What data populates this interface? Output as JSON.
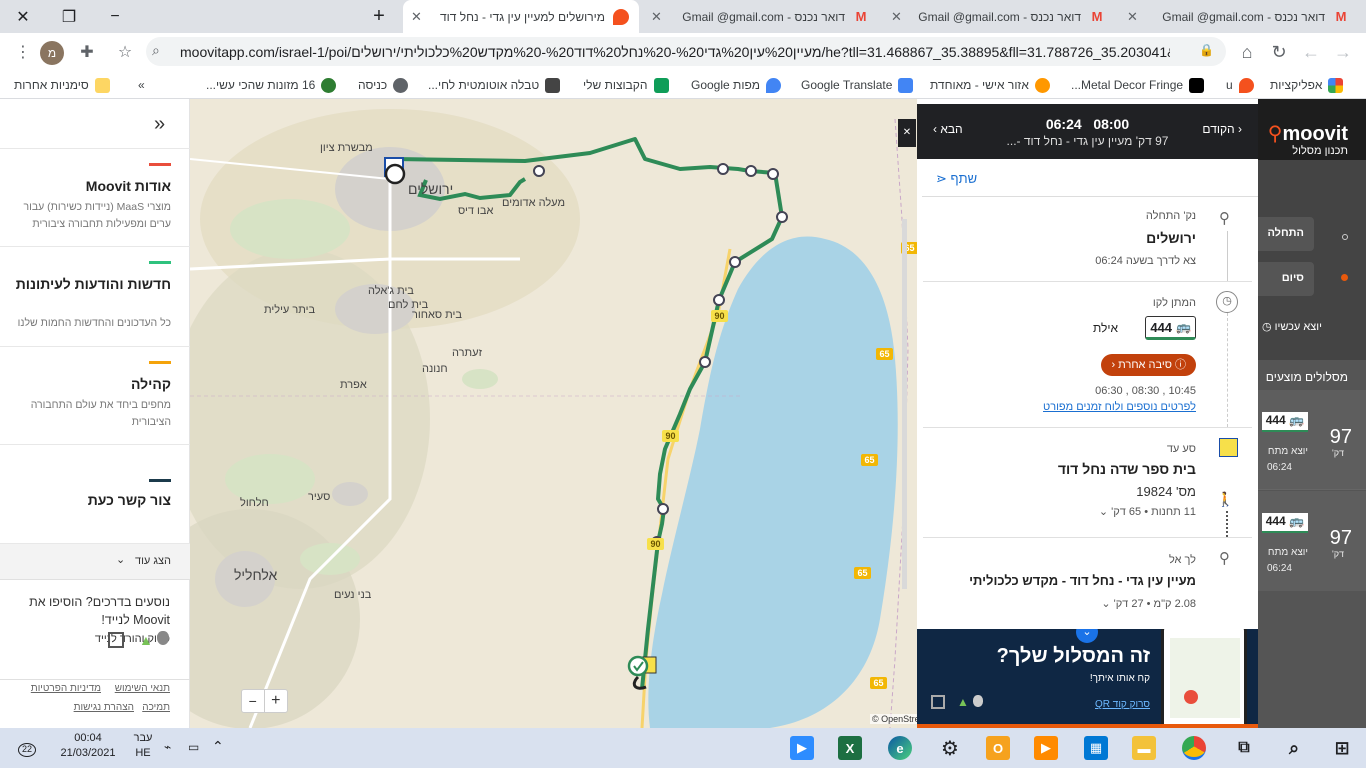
{
  "browser": {
    "tabs": [
      {
        "title": "מירושלים למעיין עין גדי - נחל דוד",
        "active": true
      },
      {
        "title": "דואר נכנס - Gmail @gmail.com",
        "active": false
      },
      {
        "title": "דואר נכנס - Gmail @gmail.com",
        "active": false
      },
      {
        "title": "דואר נכנס - Gmail @gmail.com",
        "active": false
      }
    ],
    "url": "moovitapp.com/israel-1/poi/מעיין%20עין%20גדי%20-%20נחל%20דוד%20-%20מקדש%20כלכוליתי/ירושלים/he?tll=31.468867_35.38895&fll=31.788726_35.203041&c...",
    "profile_initial": "מ",
    "bookmarks": [
      {
        "label": "אפליקציות",
        "color": "#e94235"
      },
      {
        "label": "u",
        "color": "#f4511e"
      },
      {
        "label": "",
        "color": "#000000"
      },
      {
        "label": "Metal Decor Fringe...",
        "color": "#ff9800"
      },
      {
        "label": "אזור אישי - מאוחדת",
        "color": "#4285f4"
      },
      {
        "label": "Google Translate",
        "color": "#fbbc04"
      },
      {
        "label": "מפות Google",
        "color": "#4285f4"
      },
      {
        "label": "הקבוצות שלי",
        "color": "#0f9d58"
      },
      {
        "label": "טבלה אוטומטית לחי...",
        "color": "#444444"
      },
      {
        "label": "כניסה",
        "color": "#5f6368"
      },
      {
        "label": "16 מזונות שהכי עשי...",
        "color": "#2e7d32"
      },
      {
        "label": "סימניות אחרות",
        "color": "#fdd663"
      }
    ],
    "bookmarks_more": "»"
  },
  "sidebar": {
    "collapse": "«",
    "sections": [
      {
        "title": "אודות Moovit",
        "desc": "מוצרי MaaS (ניידות כשירות) עבור ערים ומפעילות תחבורה ציבורית",
        "color": "#e94e3c"
      },
      {
        "title": "חדשות והודעות לעיתונות",
        "desc": "כל העדכונים והחדשות החמות שלנו",
        "color": "#2ec27e"
      },
      {
        "title": "קהילה",
        "desc": "מחפים ביחד את עולם התחבורה הציבורית",
        "color": "#f4a30b"
      },
      {
        "title": "צור קשר כעת",
        "desc": "",
        "color": "#1b3a4b"
      }
    ],
    "show_more": "הצג עוד",
    "app_promo": "נוסעים בדרכים? הוסיפו את Moovit לנייד!",
    "scan_label": "סרוק והורד לנייד",
    "footer_links": [
      "תנאי השימוש",
      "מדיניות הפרטיות",
      "תמיכה",
      "הצהרת נגישות"
    ]
  },
  "map": {
    "labels": {
      "jerusalem": "ירושלים",
      "mevaseret": "מבשרת ציון",
      "maale": "מעלה אדומים",
      "abudis": "אבו דיס",
      "beitjala": "בית ג'אלה",
      "beitlehem": "בית לחם",
      "beitar": "ביתר עילית",
      "sahur": "בית סאחור",
      "zaatara": "זעתרה",
      "hanoon": "חנונה",
      "efrat": "אפרת",
      "halhul": "חלחול",
      "saeir": "סעיר",
      "hebron": "אלחליל",
      "bani": "בני נעים"
    },
    "road_number": "65",
    "road_90": "90",
    "zoom_in": "+",
    "zoom_out": "−",
    "attribution": "© OpenStreetMap"
  },
  "route_panel": {
    "prev": "הקודם",
    "next": "הבא",
    "times": "06:24   08:00",
    "summary": "97 דק'  מעיין עין גדי - נחל דוד -...",
    "share": "שתף",
    "start_label": "נק' התחלה",
    "start_name": "ירושלים",
    "start_time": "צא לדרך בשעה 06:24",
    "wait_label": "המתן לקו",
    "bus_line": "444",
    "bus_dest": "אילת",
    "other_reason": "סיבה אחרת",
    "departures": "06:30 , 08:30 , 10:45",
    "details_link": "לפרטים נוספים ולוח זמנים מפורט",
    "ride_label": "סע עד",
    "stop_name": "בית ספר שדה נחל דוד",
    "stop_number": "מס' 19824",
    "ride_info": "11 תחנות  •  65 דק'",
    "walk_label": "לך אל",
    "dest_name": "מעיין עין גדי - נחל דוד - מקדש כלכוליתי",
    "walk_info": "2.08 ק\"מ  •  27 דק'",
    "promo_title": "זה המסלול שלך?",
    "promo_sub": "קח אותו איתך!",
    "promo_qr": "סרוק קוד QR"
  },
  "moovit_right": {
    "logo": "moovit",
    "nav1": "תכנון מסלול",
    "from_label": "התחלה",
    "to_label": "סיום",
    "now_label": "יוצא עכשיו",
    "suggested": "מסלולים מוצעים",
    "routes": [
      {
        "minutes": "97",
        "unit": "דק'",
        "line": "444",
        "depart": "יוצא מתח",
        "time": "06:24"
      },
      {
        "minutes": "97",
        "unit": "דק'",
        "line": "444",
        "depart": "יוצא מתח",
        "time": "06:24"
      }
    ]
  },
  "taskbar": {
    "time": "00:04",
    "date": "21/03/2021",
    "lang1": "עבר",
    "lang2": "HE",
    "notifications": "22"
  }
}
